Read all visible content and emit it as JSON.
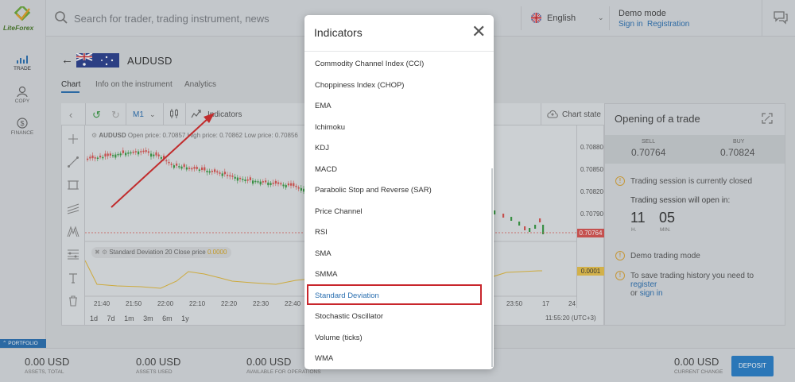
{
  "app": {
    "logo_text": "LiteForex",
    "nav": [
      {
        "label": "TRADE",
        "icon": "bar-chart-icon"
      },
      {
        "label": "COPY",
        "icon": "copy-icon"
      },
      {
        "label": "FINANCE",
        "icon": "dollar-icon"
      }
    ],
    "portfolio_tab": "PORTFOLIO"
  },
  "topbar": {
    "search_placeholder": "Search for trader, trading instrument, news",
    "language": "English",
    "demo_mode": "Demo mode",
    "sign_in": "Sign in",
    "registration": "Registration"
  },
  "instrument": {
    "symbol": "AUDUSD",
    "tabs": [
      "Chart",
      "Info on the instrument",
      "Analytics"
    ],
    "active_tab": "Chart"
  },
  "chart": {
    "period": "M1",
    "indicators_label": "Indicators",
    "chart_state_label": "Chart state",
    "legend_symbol": "AUDUSD",
    "legend_open": "Open price: 0.70857",
    "legend_high": "High price: 0.70862",
    "legend_low": "Low price: 0.70856",
    "sd_legend": "Standard Deviation 20 Close price",
    "sd_value": "0.0000",
    "price_labels": [
      "0.70880",
      "0.70850",
      "0.70820",
      "0.70790"
    ],
    "last_price": "0.70764",
    "sd_tag": "0.0001",
    "time_labels": [
      "21:40",
      "21:50",
      "22:00",
      "22:10",
      "22:20",
      "22:30",
      "22:40",
      "23:50",
      "17",
      "24"
    ],
    "timeframes": [
      "1d",
      "7d",
      "1m",
      "3m",
      "6m",
      "1y"
    ],
    "clock": "11:55:20 (UTC+3)",
    "colors": {
      "up": "#3a9a44",
      "down": "#d9534f",
      "sd_line": "#e2b93b"
    }
  },
  "trade": {
    "title": "Opening of a trade",
    "sell_label": "SELL",
    "sell_price": "0.70764",
    "buy_label": "BUY",
    "buy_price": "0.70824",
    "session_closed": "Trading session is currently closed",
    "will_open": "Trading session will open in:",
    "hours": "11",
    "minutes": "05",
    "hours_label": "H.",
    "minutes_label": "MIN.",
    "demo_trading": "Demo trading mode",
    "save_prefix": "To save trading history you need to",
    "register": "register",
    "or": "or",
    "sign_in": "sign in"
  },
  "bottom": {
    "items": [
      {
        "value": "0.00 USD",
        "label": "ASSETS, TOTAL"
      },
      {
        "value": "0.00 USD",
        "label": "ASSETS USED"
      },
      {
        "value": "0.00 USD",
        "label": "AVAILABLE FOR OPERATIONS"
      },
      {
        "value": "0.00 USD",
        "label": "CURRENT CHANGE"
      }
    ],
    "deposit": "DEPOSIT"
  },
  "modal": {
    "title": "Indicators",
    "items": [
      "Commodity Channel Index (CCI)",
      "Choppiness Index (CHOP)",
      "EMA",
      "Ichimoku",
      "KDJ",
      "MACD",
      "Parabolic Stop and Reverse (SAR)",
      "Price Channel",
      "RSI",
      "SMA",
      "SMMA",
      "Standard Deviation",
      "Stochastic Oscillator",
      "Volume (ticks)",
      "WMA"
    ],
    "highlighted": "Standard Deviation",
    "highlight_color": "#c8262c",
    "link_color": "#2a6fb0"
  }
}
